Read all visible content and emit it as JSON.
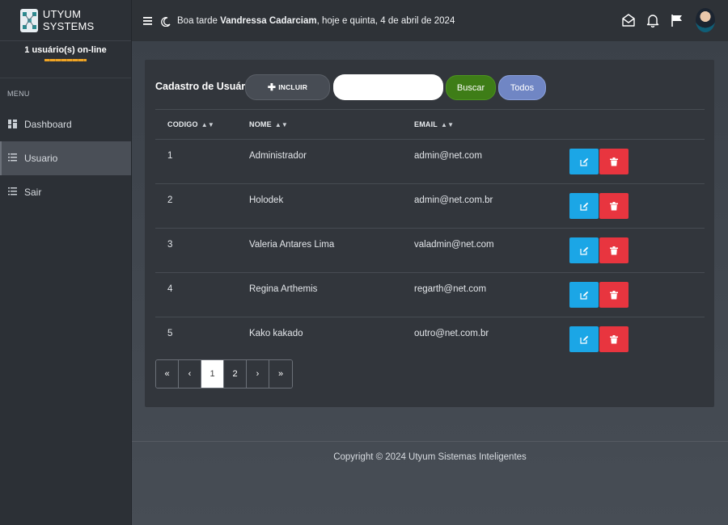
{
  "brand": {
    "name": "UTYUM SYSTEMS"
  },
  "online": {
    "text": "1 usuário(s) on-line"
  },
  "menu": {
    "title": "MENU",
    "items": [
      {
        "label": "Dashboard",
        "icon": "dashboard-icon"
      },
      {
        "label": "Usuario",
        "icon": "list-icon",
        "active": true
      },
      {
        "label": "Sair",
        "icon": "list-icon"
      }
    ]
  },
  "topbar": {
    "greeting_prefix": "Boa tarde ",
    "user_name": "Vandressa Cadarciam",
    "greeting_suffix": ", hoje e quinta, 4 de abril de 2024",
    "icons": [
      "mail-open-icon",
      "bell-icon",
      "flag-icon",
      "avatar"
    ]
  },
  "card": {
    "title": "Cadastro de Usuários",
    "include_label": "INCLUIR",
    "search_value": "",
    "search_label": "Buscar",
    "all_label": "Todos"
  },
  "table": {
    "headers": {
      "code": "CODIGO",
      "name": "NOME",
      "email": "EMAIL"
    },
    "rows": [
      {
        "code": "1",
        "name": "Administrador",
        "email": "admin@net.com"
      },
      {
        "code": "2",
        "name": "Holodek",
        "email": "admin@net.com.br"
      },
      {
        "code": "3",
        "name": "Valeria Antares Lima",
        "email": "valadmin@net.com"
      },
      {
        "code": "4",
        "name": "Regina Arthemis",
        "email": "regarth@net.com"
      },
      {
        "code": "5",
        "name": "Kako kakado",
        "email": "outro@net.com.br"
      }
    ]
  },
  "pagination": {
    "first": "«",
    "prev": "‹",
    "pages": [
      "1",
      "2"
    ],
    "current": "1",
    "next": "›",
    "last": "»"
  },
  "footer": {
    "text": "Copyright © 2024 Utyum Sistemas Inteligentes"
  },
  "colors": {
    "buscar": "#3e7d17",
    "todos": "#7086c4",
    "edit": "#1ba6e6",
    "delete": "#e8353f",
    "online_bar": "#f0a526"
  }
}
